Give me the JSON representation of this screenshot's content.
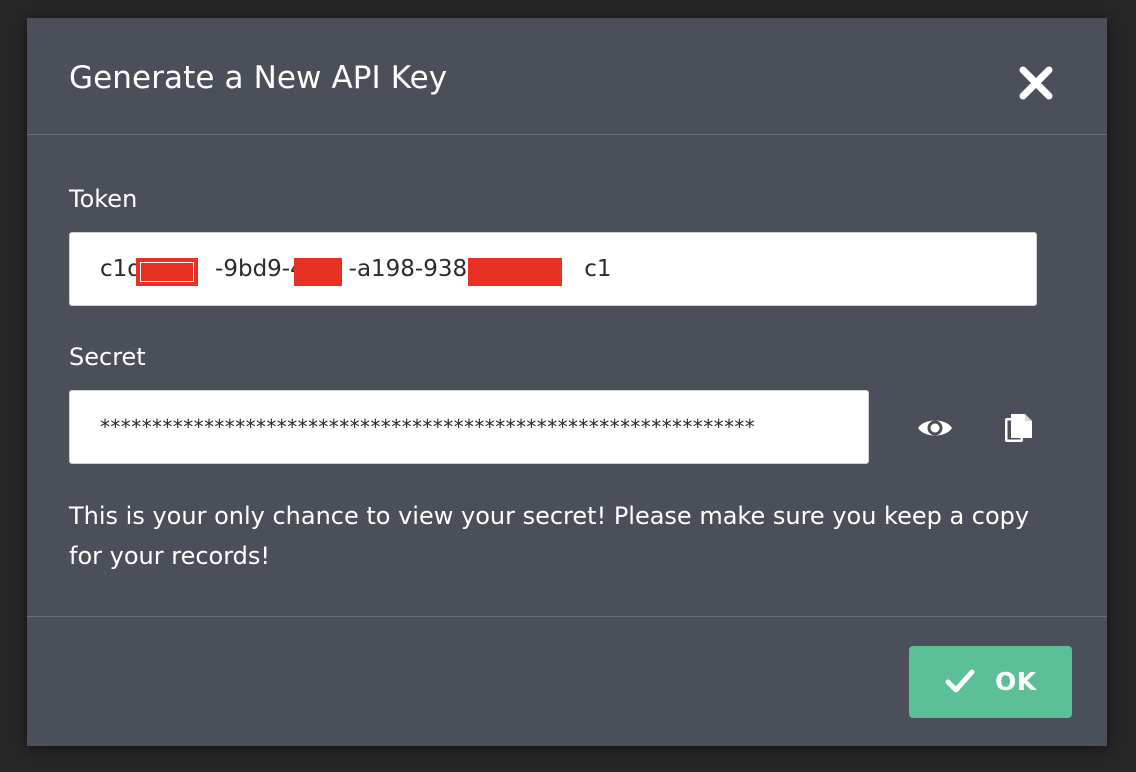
{
  "dialog": {
    "title": "Generate a New API Key",
    "close_icon": "close-icon"
  },
  "token": {
    "label": "Token",
    "value": "c1d     -9bd9-4   -a198-938        c1",
    "redacted": true
  },
  "secret": {
    "label": "Secret",
    "value": "***************************************************************",
    "show_icon": "eye-icon",
    "copy_icon": "copy-icon"
  },
  "message": "This is your only chance to view your secret! Please make sure you keep a copy for your records!",
  "ok_button": {
    "label": "OK",
    "icon": "check-icon"
  },
  "colors": {
    "backdrop": "#272727",
    "dialog_bg": "#4b4f59",
    "ok_button": "#5cbf97",
    "redaction": "#e83023"
  }
}
